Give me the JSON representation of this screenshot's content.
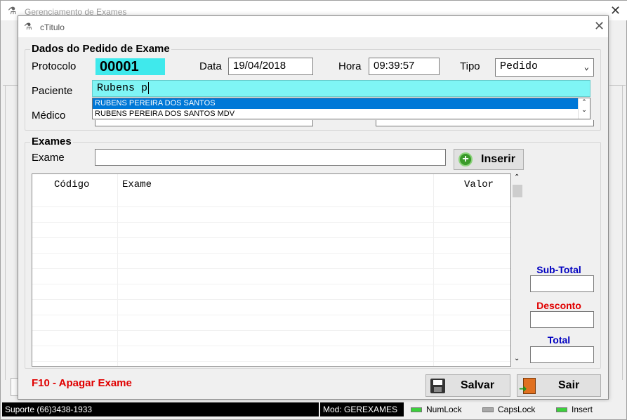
{
  "background_window": {
    "title": "Gerenciamento de Exames"
  },
  "dialog": {
    "title": "cTitulo"
  },
  "pedido": {
    "group_title": "Dados do Pedido de Exame",
    "protocolo_label": "Protocolo",
    "protocolo_value": "00001",
    "data_label": "Data",
    "data_value": "19/04/2018",
    "hora_label": "Hora",
    "hora_value": "09:39:57",
    "tipo_label": "Tipo",
    "tipo_value": "Pedido",
    "paciente_label": "Paciente",
    "paciente_value": "Rubens p",
    "medico_label": "Médico",
    "suggestions": [
      "RUBENS PEREIRA DOS SANTOS",
      "RUBENS PEREIRA DOS SANTOS MDV"
    ]
  },
  "exames": {
    "group_title": "Exames",
    "exame_label": "Exame",
    "exame_value": "",
    "insert_label": "Inserir",
    "columns": [
      "Código",
      "Exame",
      "Valor"
    ],
    "rows": []
  },
  "totals": {
    "subtotal_label": "Sub-Total",
    "desconto_label": "Desconto",
    "total_label": "Total",
    "colors": {
      "subtotal": "#0000c0",
      "desconto": "#e00000",
      "total": "#0000c0"
    }
  },
  "footer": {
    "hint": "F10 - Apagar Exame",
    "save_label": "Salvar",
    "exit_label": "Sair"
  },
  "statusbar": {
    "support": "Suporte (66)3438-1933",
    "module": "Mod: GEREXAMES",
    "numlock": "NumLock",
    "capslock": "CapsLock",
    "insert": "Insert"
  }
}
